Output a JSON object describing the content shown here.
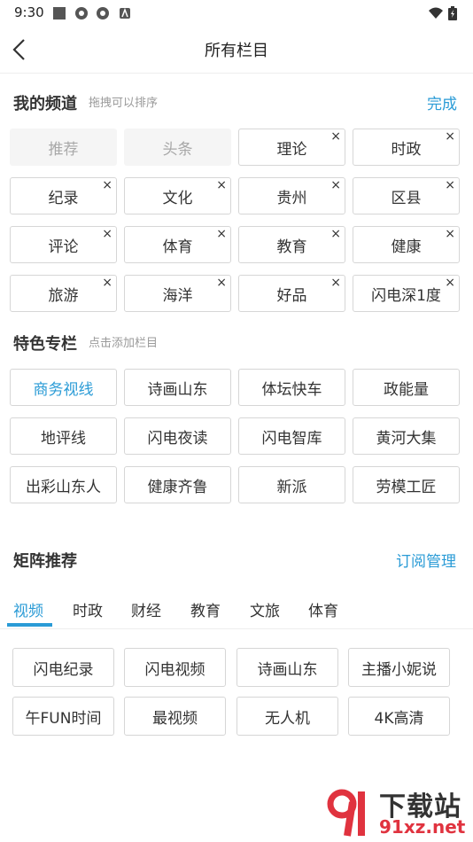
{
  "status_bar": {
    "time": "9:30"
  },
  "header": {
    "title": "所有栏目"
  },
  "my_channels": {
    "title": "我的频道",
    "hint": "拖拽可以排序",
    "action": "完成",
    "fixed": [
      "推荐",
      "头条"
    ],
    "items": [
      "理论",
      "时政",
      "纪录",
      "文化",
      "贵州",
      "区县",
      "评论",
      "体育",
      "教育",
      "健康",
      "旅游",
      "海洋",
      "好品",
      "闪电深1度"
    ],
    "close_symbol": "×"
  },
  "featured": {
    "title": "特色专栏",
    "hint": "点击添加栏目",
    "items": [
      "商务视线",
      "诗画山东",
      "体坛快车",
      "政能量",
      "地评线",
      "闪电夜读",
      "闪电智库",
      "黄河大集",
      "出彩山东人",
      "健康齐鲁",
      "新派",
      "劳模工匠"
    ]
  },
  "matrix": {
    "title": "矩阵推荐",
    "action": "订阅管理",
    "tabs": [
      "视频",
      "时政",
      "财经",
      "教育",
      "文旅",
      "体育"
    ],
    "active_tab": "视频",
    "items": [
      "闪电纪录",
      "闪电视频",
      "诗画山东",
      "主播小妮说",
      "午FUN时间",
      "最视频",
      "无人机",
      "4K高清"
    ]
  },
  "watermark": {
    "line1": "下载站",
    "line2": "91xz.net"
  },
  "colors": {
    "accent": "#2a9bd6",
    "border": "#d6d6d6",
    "fixed_bg": "#f5f5f5",
    "watermark_red": "#e0333f"
  }
}
